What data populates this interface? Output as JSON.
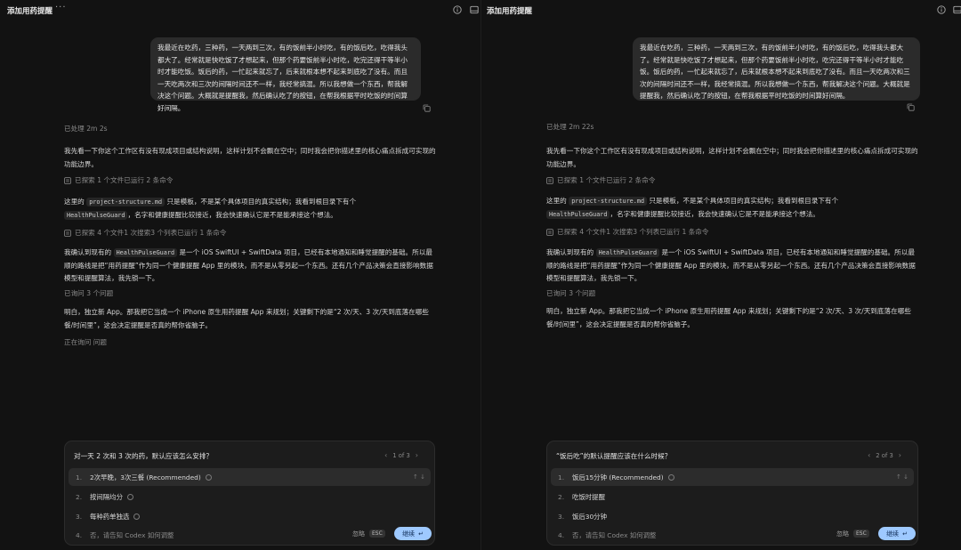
{
  "left": {
    "title": "添加用药提醒",
    "more": "···",
    "user_message": "我最近在吃药，三种药，一天两到三次，有的饭前半小时吃，有的饭后吃，吃得我头都大了。经常就是快吃饭了才想起来，但那个药要饭前半小时吃，吃完还得干等半小时才能吃饭。饭后的药，一忙起来就忘了，后来就根本想不起来到底吃了没有。而且一天吃两次和三次的间隔时间还不一样，我经常搞混。所以我想做一个东西，帮我解决这个问题。大概就是提醒我，然后确认吃了的按钮，在帮我根据平时吃饭的时间算好间隔。",
    "processed": "已处理 2m 2s",
    "p1": "我先看一下你这个工作区有没有现成项目或结构说明，这样计划不会飘在空中；同时我会把你描述里的核心痛点拆成可实现的功能边界。",
    "explore1": "已探索 1 个文件已运行 2 条命令",
    "p2a": "这里的",
    "p2code1": "project-structure.md",
    "p2b": "只是模板，不是某个具体项目的真实结构；我看到根目录下有个",
    "p2code2": "HealthPulseGuard",
    "p2c": "，名字和健康提醒比较接近，我会快速确认它是不是能承接这个想法。",
    "explore2": "已探索 4 个文件1 次搜索3 个列表已运行 1 条命令",
    "p3a": "我确认到现有的",
    "p3code": "HealthPulseGuard",
    "p3b": "是一个 iOS SwiftUI + SwiftData 项目，已经有本地通知和睡觉提醒的基础。所以最顺的路线是把“用药提醒”作为同一个健康提醒 App 里的模块，而不是从零另起一个东西。还有几个产品决策会直接影响数据模型和提醒算法，我先锁一下。",
    "asked": "已询问 3 个问题",
    "p4": "明白，独立新 App。那我把它当成一个 iPhone 原生用药提醒 App 来规划；关键剩下的是“2 次/天、3 次/天到底落在哪些餐/时间里”，这会决定提醒是否真的帮你省脑子。",
    "asking": "正在询问 问题",
    "question": "对一天 2 次和 3 次的药，默认应该怎么安排？",
    "pager": "1 of 3",
    "options": [
      {
        "num": "1.",
        "label": "2次早晚，3次三餐 (Recommended)"
      },
      {
        "num": "2.",
        "label": "按间隔均分"
      },
      {
        "num": "3.",
        "label": "每种药单独选"
      }
    ],
    "other": {
      "num": "4.",
      "label": "否，请告知 Codex 如何调整"
    },
    "skip": "忽略",
    "esc": "ESC",
    "continue": "继续",
    "continue_icon": "↵"
  },
  "right": {
    "title": "添加用药提醒",
    "user_message": "我最近在吃药，三种药，一天两到三次，有的饭前半小时吃，有的饭后吃，吃得我头都大了。经常就是快吃饭了才想起来，但那个药要饭前半小时吃，吃完还得干等半小时才能吃饭。饭后的药，一忙起来就忘了，后来就根本想不起来到底吃了没有。而且一天吃两次和三次的间隔时间还不一样，我经常搞混。所以我想做一个东西，帮我解决这个问题。大概就是提醒我，然后确认吃了的按钮，在帮我根据平时吃饭的时间算好间隔。",
    "processed": "已处理 2m 22s",
    "p1": "我先看一下你这个工作区有没有现成项目或结构说明，这样计划不会飘在空中；同时我会把你描述里的核心痛点拆成可实现的功能边界。",
    "explore1": "已探索 1 个文件已运行 2 条命令",
    "p2a": "这里的",
    "p2code1": "project-structure.md",
    "p2b": "只是模板，不是某个具体项目的真实结构；我看到根目录下有个",
    "p2code2": "HealthPulseGuard",
    "p2c": "，名字和健康提醒比较接近，我会快速确认它是不是能承接这个想法。",
    "explore2": "已探索 4 个文件1 次搜索3 个列表已运行 1 条命令",
    "p3a": "我确认到现有的",
    "p3code": "HealthPulseGuard",
    "p3b": "是一个 iOS SwiftUI + SwiftData 项目，已经有本地通知和睡觉提醒的基础。所以最顺的路线是把“用药提醒”作为同一个健康提醒 App 里的模块，而不是从零另起一个东西。还有几个产品决策会直接影响数据模型和提醒算法，我先锁一下。",
    "asked": "已询问 3 个问题",
    "p4": "明白，独立新 App。那我把它当成一个 iPhone 原生用药提醒 App 来规划；关键剩下的是“2 次/天、3 次/天到底落在哪些餐/时间里”，这会决定提醒是否真的帮你省脑子。",
    "question": "“饭后吃”的默认提醒应该在什么时候？",
    "pager": "2 of 3",
    "options": [
      {
        "num": "1.",
        "label": "饭后15分钟 (Recommended)"
      },
      {
        "num": "2.",
        "label": "吃饭时提醒"
      },
      {
        "num": "3.",
        "label": "饭后30分钟"
      }
    ],
    "other": {
      "num": "4.",
      "label": "否，请告知 Codex 如何调整"
    },
    "skip": "忽略",
    "esc": "ESC",
    "continue": "继续",
    "continue_icon": "↵"
  },
  "icons": {
    "info": "info-icon",
    "panel": "panel-icon",
    "copy": "copy-icon",
    "explore": "explore-icon"
  },
  "colors": {
    "background": "#121212",
    "bubble": "#2b2b2b",
    "accent": "#9ec9ff"
  }
}
